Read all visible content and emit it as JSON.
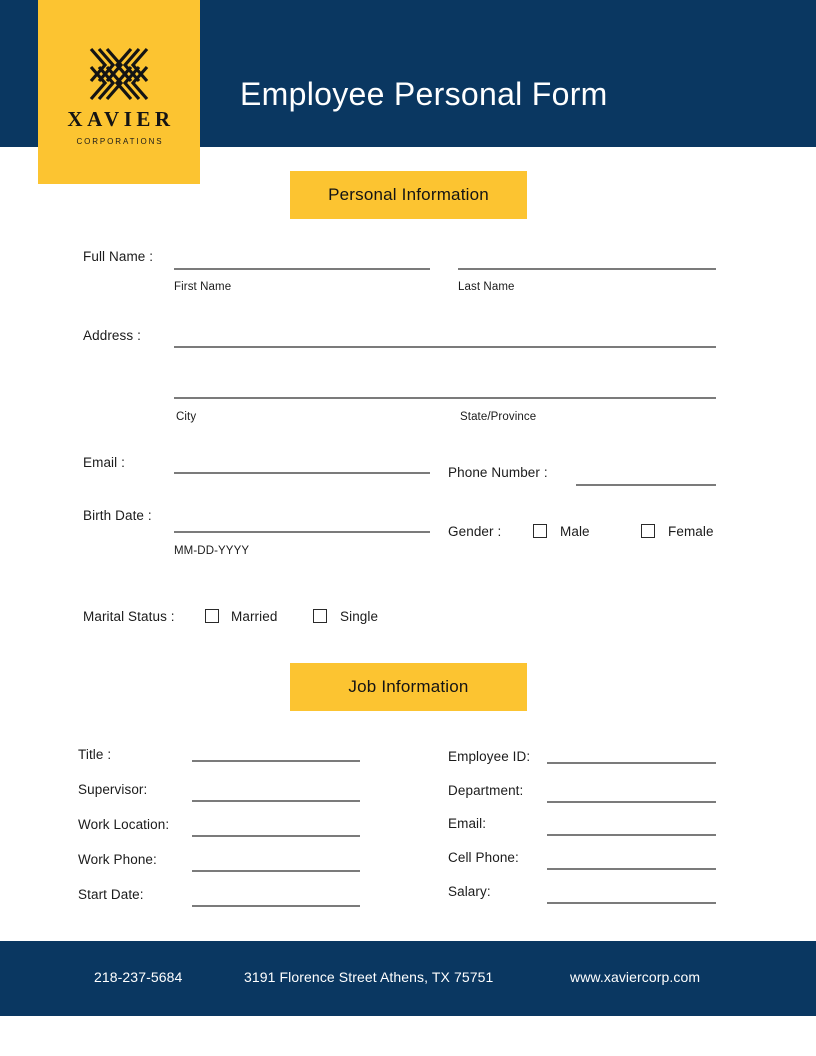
{
  "header": {
    "title": "Employee Personal Form",
    "logo": {
      "mark": "x-chevron-logo-icon",
      "wordmark": "XAVIER",
      "tagline": "CORPORATIONS"
    }
  },
  "sections": {
    "personal_banner": "Personal Information",
    "job_banner": "Job Information"
  },
  "personal": {
    "full_name_label": "Full Name :",
    "first_name_hint": "First Name",
    "last_name_hint": "Last Name",
    "address_label": "Address :",
    "city_hint": "City",
    "state_hint": "State/Province",
    "email_label": "Email :",
    "phone_label": "Phone Number :",
    "birth_date_label": "Birth Date :",
    "birth_date_hint": "MM-DD-YYYY",
    "gender_label": "Gender :",
    "gender_options": [
      "Male",
      "Female"
    ],
    "marital_label": "Marital Status :",
    "marital_options": [
      "Married",
      "Single"
    ]
  },
  "job": {
    "left": [
      {
        "label": "Title :"
      },
      {
        "label": "Supervisor:"
      },
      {
        "label": "Work Location:"
      },
      {
        "label": "Work Phone:"
      },
      {
        "label": "Start Date:"
      }
    ],
    "right": [
      {
        "label": "Employee ID:"
      },
      {
        "label": "Department:"
      },
      {
        "label": "Email:"
      },
      {
        "label": "Cell Phone:"
      },
      {
        "label": "Salary:"
      }
    ]
  },
  "footer": {
    "phone": "218-237-5684",
    "address": "3191 Florence Street Athens, TX 75751",
    "website": "www.xaviercorp.com"
  },
  "colors": {
    "navy": "#0a3761",
    "yellow": "#fcc431",
    "line": "#7b7b7b",
    "text": "#1b1b1b"
  }
}
